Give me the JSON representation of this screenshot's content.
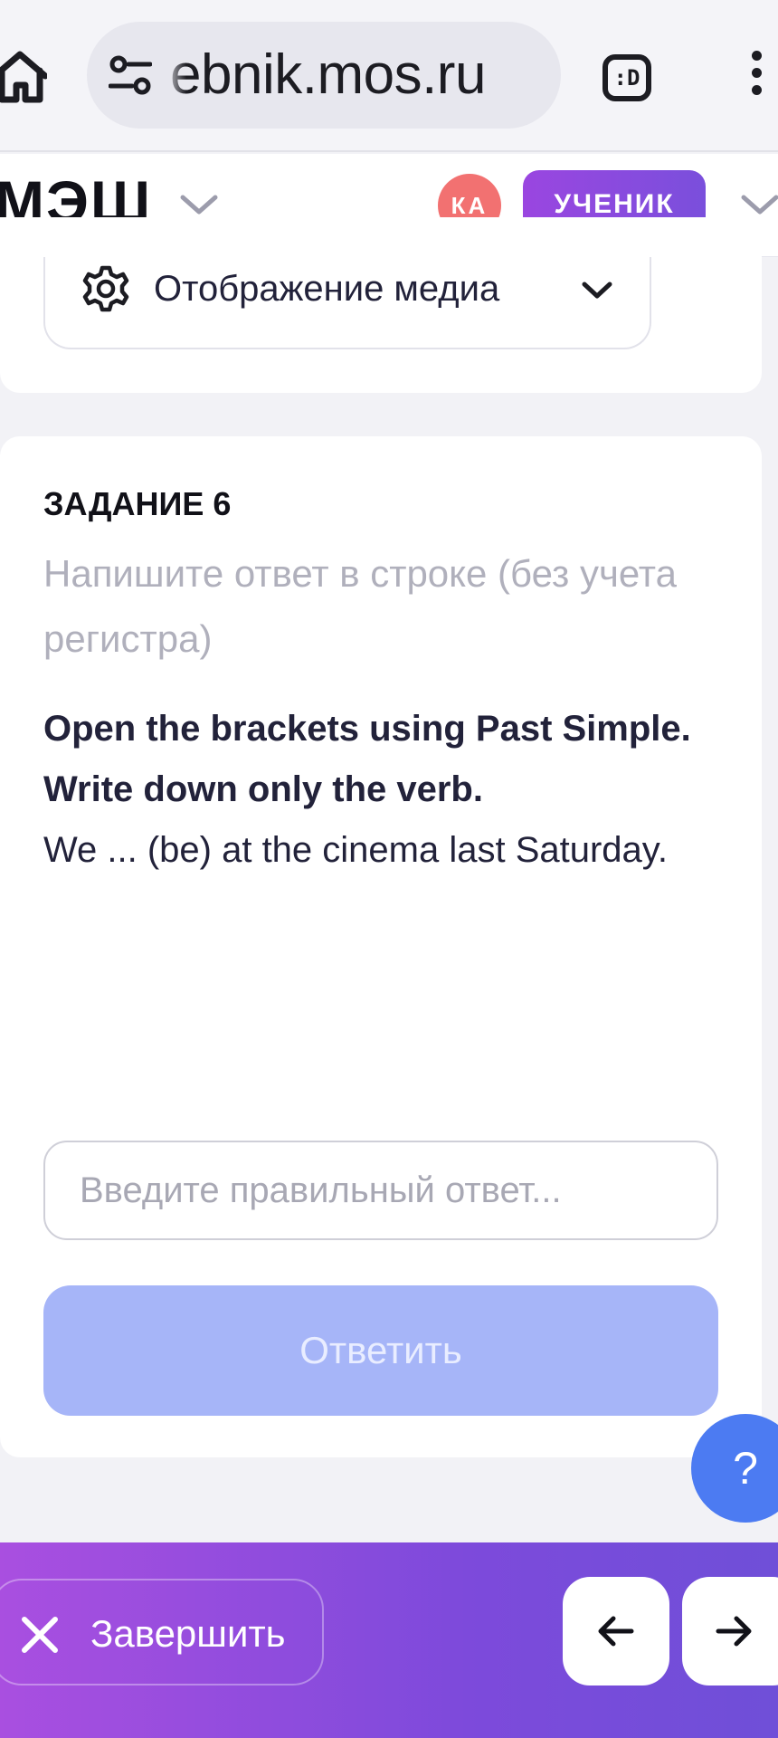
{
  "browser": {
    "url_text": "ebnik.mos.ru",
    "tabs_label": ":D"
  },
  "header": {
    "logo_text": "МЭШ",
    "avatar_initials": "КА",
    "role_label": "УЧЕНИК"
  },
  "media": {
    "label": "Отображение медиа"
  },
  "task": {
    "number_label": "ЗАДАНИЕ 6",
    "hint": "Напишите ответ в строке (без учета регистра)",
    "instruction": "Open the brackets using Past Simple. Write down only the verb.",
    "sentence": "We ... (be) at the cinema last Saturday.",
    "input_placeholder": "Введите правильный ответ...",
    "submit_label": "Ответить"
  },
  "help": {
    "label": "?"
  },
  "footer": {
    "finish_label": "Завершить"
  },
  "colors": {
    "accent_purple": "#8a4ae0",
    "avatar_red": "#f27171",
    "submit_disabled": "#a6b5f8",
    "help_blue": "#4c7bf2"
  },
  "icons": [
    "home-icon",
    "tune-icon",
    "tabs-icon",
    "more-vert-icon",
    "chevron-down-icon",
    "gear-icon",
    "close-icon",
    "arrow-left-icon",
    "arrow-right-icon"
  ]
}
